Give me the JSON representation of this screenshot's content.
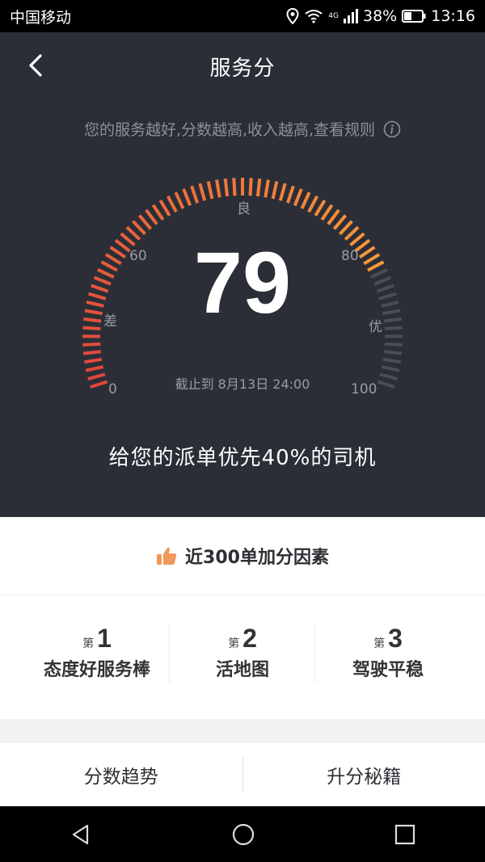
{
  "status_bar": {
    "carrier": "中国移动",
    "network": "4G",
    "battery": "38%",
    "time": "13:16"
  },
  "header": {
    "title": "服务分"
  },
  "subtitle": {
    "text": "您的服务越好,分数越高,收入越高,查看规则"
  },
  "gauge": {
    "score": "79",
    "score_fraction": 0.79,
    "labels": {
      "min": "0",
      "sixty": "60",
      "eighty": "80",
      "max": "100",
      "poor": "差",
      "good": "良",
      "excellent": "优"
    },
    "deadline": "截止到 8月13日 24:00",
    "colors": {
      "low": "#e0443c",
      "high": "#f79a3b",
      "inactive": "#4a4d56"
    }
  },
  "rank_text": "给您的派单优先40%的司机",
  "factors": {
    "title": "近300单加分因素",
    "items": [
      {
        "prefix": "第",
        "rank": "1",
        "name": "态度好服务棒"
      },
      {
        "prefix": "第",
        "rank": "2",
        "name": "活地图"
      },
      {
        "prefix": "第",
        "rank": "3",
        "name": "驾驶平稳"
      }
    ]
  },
  "bottom_tabs": {
    "trend": "分数趋势",
    "tips": "升分秘籍"
  },
  "icons": {
    "back": "chevron-left-icon",
    "info": "info-icon",
    "thumb": "thumbs-up-icon"
  }
}
